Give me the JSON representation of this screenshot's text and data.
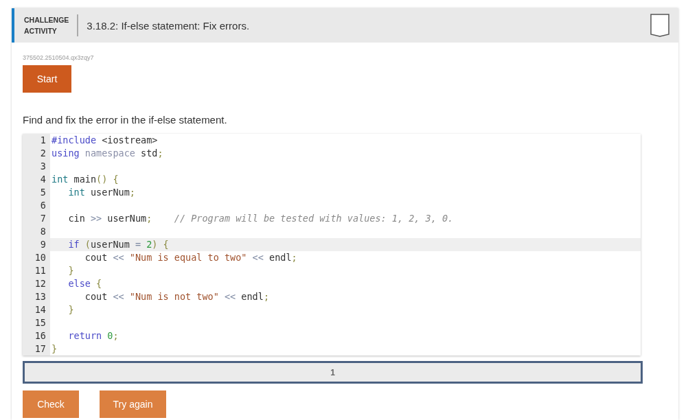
{
  "header": {
    "badge_line1": "CHALLENGE",
    "badge_line2": "ACTIVITY",
    "title": "3.18.2: If-else statement: Fix errors."
  },
  "activity_id": "375502.2510504.qx3zqy7",
  "start_button": "Start",
  "instructions": "Find and fix the error in the if-else statement.",
  "code_lines": [
    {
      "number": "1",
      "active": false,
      "tokens": [
        {
          "kind": "keyword",
          "text": "#include"
        },
        {
          "kind": "plain",
          "text": " <iostream>"
        }
      ]
    },
    {
      "number": "2",
      "active": false,
      "tokens": [
        {
          "kind": "keyword",
          "text": "using"
        },
        {
          "kind": "muted",
          "text": " namespace"
        },
        {
          "kind": "plain",
          "text": " std"
        },
        {
          "kind": "punct",
          "text": ";"
        }
      ]
    },
    {
      "number": "3",
      "active": false
    },
    {
      "number": "4",
      "active": false,
      "tokens": [
        {
          "kind": "type",
          "text": "int"
        },
        {
          "kind": "plain",
          "text": " main"
        },
        {
          "kind": "punct",
          "text": "() {"
        }
      ],
      "children": [
        {
          "number": "5",
          "active": false,
          "tokens": [
            {
              "kind": "type",
              "text": "int"
            },
            {
              "kind": "plain",
              "text": " userNum"
            },
            {
              "kind": "punct",
              "text": ";"
            }
          ]
        },
        {
          "number": "6",
          "active": false
        },
        {
          "number": "7",
          "active": false,
          "tokens": [
            {
              "kind": "plain",
              "text": "cin "
            },
            {
              "kind": "operator",
              "text": ">>"
            },
            {
              "kind": "plain",
              "text": " userNum"
            },
            {
              "kind": "punct",
              "text": ";"
            },
            {
              "kind": "comment",
              "text": "    // Program will be tested with values: 1, 2, 3, 0."
            }
          ]
        },
        {
          "number": "8",
          "active": false
        },
        {
          "number": "9",
          "active": true,
          "tokens": [
            {
              "kind": "keyword",
              "text": "if"
            },
            {
              "kind": "punct",
              "text": " ("
            },
            {
              "kind": "plain",
              "text": "userNum "
            },
            {
              "kind": "operator",
              "text": "="
            },
            {
              "kind": "number",
              "text": " 2"
            },
            {
              "kind": "punct",
              "text": ") {"
            }
          ],
          "children": [
            {
              "number": "10",
              "active": false,
              "tokens": [
                {
                  "kind": "plain",
                  "text": "cout "
                },
                {
                  "kind": "operator",
                  "text": "<<"
                },
                {
                  "kind": "string",
                  "text": " \"Num is equal to two\""
                },
                {
                  "kind": "operator",
                  "text": " <<"
                },
                {
                  "kind": "plain",
                  "text": " endl"
                },
                {
                  "kind": "punct",
                  "text": ";"
                }
              ]
            }
          ]
        },
        {
          "number": "11",
          "active": false,
          "tokens": [
            {
              "kind": "punct",
              "text": "}"
            }
          ]
        },
        {
          "number": "12",
          "active": false,
          "tokens": [
            {
              "kind": "keyword",
              "text": "else"
            },
            {
              "kind": "punct",
              "text": " {"
            }
          ],
          "children": [
            {
              "number": "13",
              "active": false,
              "tokens": [
                {
                  "kind": "plain",
                  "text": "cout "
                },
                {
                  "kind": "operator",
                  "text": "<<"
                },
                {
                  "kind": "string",
                  "text": " \"Num is not two\""
                },
                {
                  "kind": "operator",
                  "text": " <<"
                },
                {
                  "kind": "plain",
                  "text": " endl"
                },
                {
                  "kind": "punct",
                  "text": ";"
                }
              ]
            }
          ]
        },
        {
          "number": "14",
          "active": false,
          "tokens": [
            {
              "kind": "punct",
              "text": "}"
            }
          ]
        },
        {
          "number": "15",
          "active": false
        },
        {
          "number": "16",
          "active": false,
          "tokens": [
            {
              "kind": "keyword",
              "text": "return"
            },
            {
              "kind": "number",
              "text": " 0"
            },
            {
              "kind": "punct",
              "text": ";"
            }
          ]
        }
      ]
    },
    {
      "number": "17",
      "active": false,
      "tokens": [
        {
          "kind": "punct",
          "text": "}"
        }
      ]
    }
  ],
  "progress": [
    {
      "label": "1",
      "selected": true
    }
  ],
  "buttons": [
    {
      "label": "Check"
    },
    {
      "label": "Try again"
    }
  ]
}
